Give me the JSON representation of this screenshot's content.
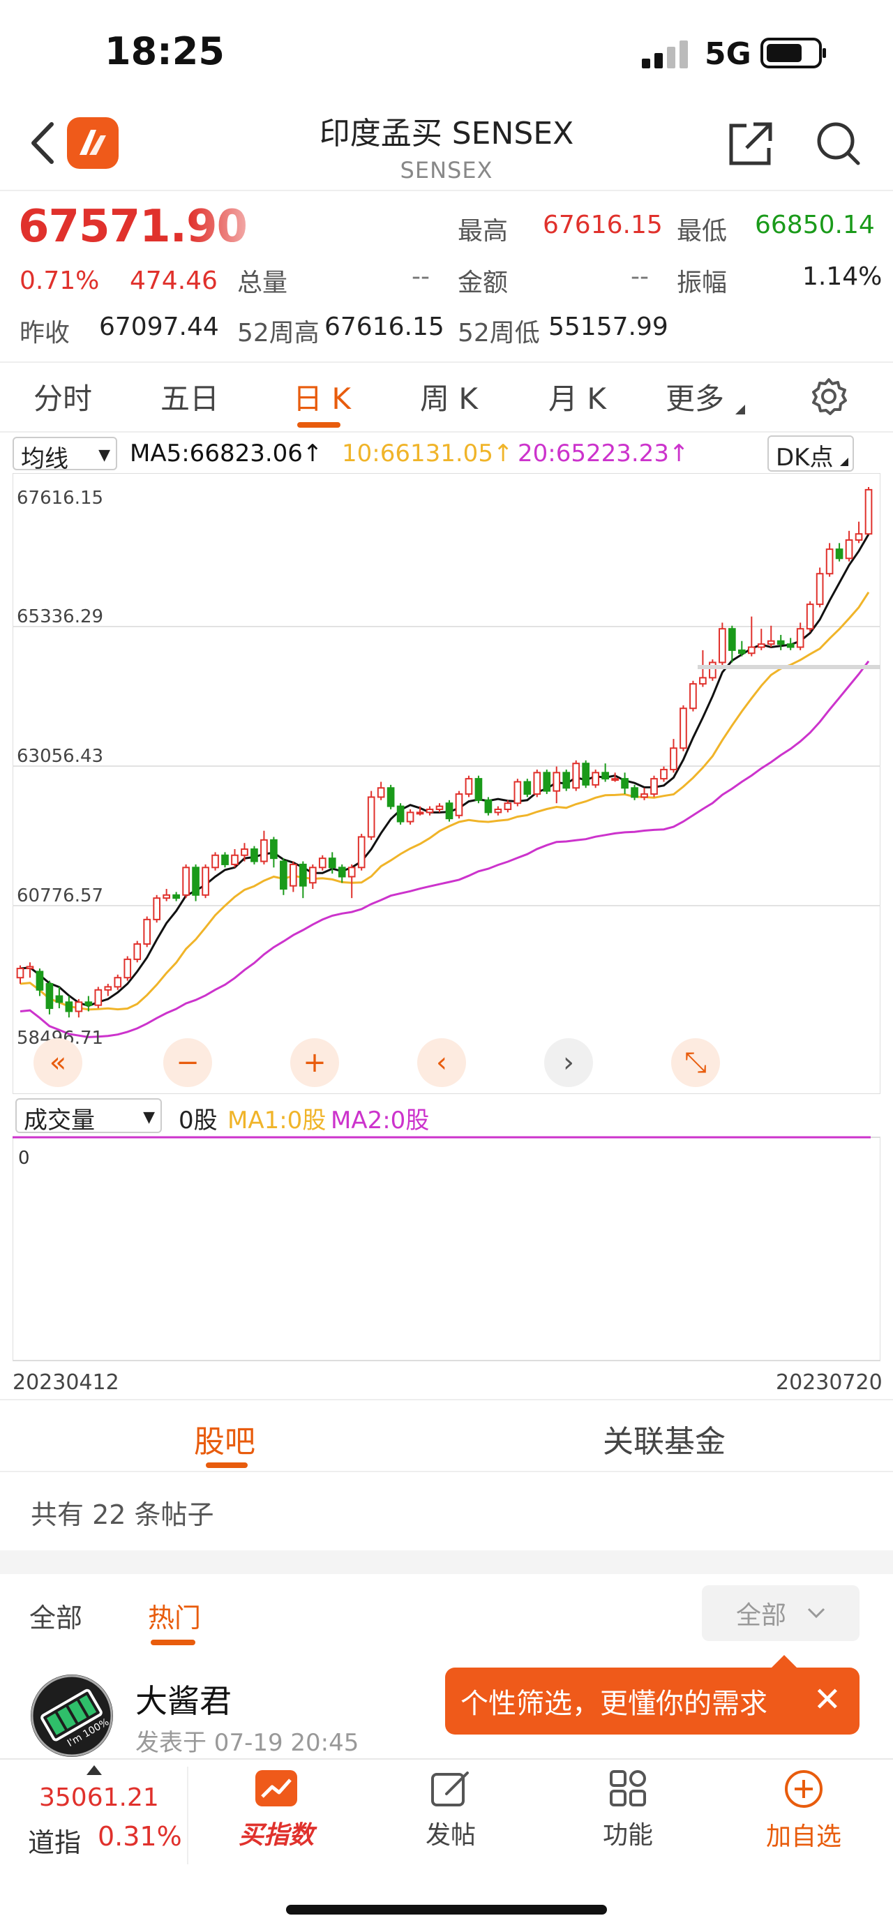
{
  "status_bar": {
    "time": "18:25",
    "network": "5G"
  },
  "header": {
    "title": "印度孟买 SENSEX",
    "subtitle": "SENSEX"
  },
  "quote": {
    "price": "67571.90",
    "change_pct": "0.71%",
    "change_abs": "474.46",
    "high_label": "最高",
    "high": "67616.15",
    "low_label": "最低",
    "low": "66850.14",
    "volume_label": "总量",
    "volume": "--",
    "amount_label": "金额",
    "amount": "--",
    "amplitude_label": "振幅",
    "amplitude": "1.14%",
    "prev_close_label": "昨收",
    "prev_close": "67097.44",
    "week52_high_label": "52周高",
    "week52_high": "67616.15",
    "week52_low_label": "52周低",
    "week52_low": "55157.99"
  },
  "chart_tabs": [
    "分时",
    "五日",
    "日 K",
    "周 K",
    "月 K",
    "更多"
  ],
  "ma_bar": {
    "selector": "均线",
    "ma5": "MA5:66823.06",
    "ma10": "10:66131.05",
    "ma20": "20:65223.23",
    "dk": "DK点"
  },
  "colors": {
    "up": "#e0312c",
    "down": "#1a9a1a",
    "ma5": "#111111",
    "ma10": "#f0b429",
    "ma20": "#cc33cc",
    "accent": "#e85c0d"
  },
  "chart_data": {
    "type": "candlestick",
    "y_ticks": [
      "67616.15",
      "65336.29",
      "63056.43",
      "60776.57",
      "58496.71"
    ],
    "ylim": [
      58496.71,
      67616.15
    ],
    "x_start": "20230412",
    "x_end": "20230720",
    "candles": [
      [
        59600,
        59750,
        59500,
        59800
      ],
      [
        59750,
        59780,
        59600,
        59850
      ],
      [
        59700,
        59400,
        59300,
        59750
      ],
      [
        59500,
        59100,
        59000,
        59550
      ],
      [
        59300,
        59200,
        59100,
        59450
      ],
      [
        59200,
        59050,
        58950,
        59300
      ],
      [
        59050,
        59200,
        58950,
        59250
      ],
      [
        59200,
        59150,
        59050,
        59300
      ],
      [
        59150,
        59400,
        59100,
        59450
      ],
      [
        59400,
        59450,
        59300,
        59500
      ],
      [
        59450,
        59600,
        59400,
        59650
      ],
      [
        59600,
        59900,
        59550,
        59950
      ],
      [
        59900,
        60150,
        59850,
        60200
      ],
      [
        60150,
        60550,
        60100,
        60600
      ],
      [
        60550,
        60900,
        60500,
        60950
      ],
      [
        60900,
        60950,
        60850,
        61050
      ],
      [
        60950,
        60900,
        60850,
        61000
      ],
      [
        60950,
        61400,
        60900,
        61450
      ],
      [
        61400,
        60950,
        60850,
        61450
      ],
      [
        60950,
        61400,
        60900,
        61450
      ],
      [
        61400,
        61600,
        61350,
        61650
      ],
      [
        61600,
        61450,
        61400,
        61650
      ],
      [
        61450,
        61600,
        61400,
        61700
      ],
      [
        61600,
        61700,
        61500,
        61800
      ],
      [
        61700,
        61500,
        61450,
        61750
      ],
      [
        61500,
        61850,
        61450,
        62000
      ],
      [
        61850,
        61550,
        61400,
        61900
      ],
      [
        61500,
        61050,
        60950,
        61550
      ],
      [
        61100,
        61450,
        61000,
        61500
      ],
      [
        61450,
        61100,
        60900,
        61500
      ],
      [
        61150,
        61400,
        61050,
        61450
      ],
      [
        61400,
        61550,
        61350,
        61600
      ],
      [
        61550,
        61400,
        61300,
        61650
      ],
      [
        61400,
        61250,
        61150,
        61450
      ],
      [
        61250,
        61400,
        60900,
        61450
      ],
      [
        61400,
        61900,
        61350,
        61950
      ],
      [
        61900,
        62550,
        61850,
        62650
      ],
      [
        62550,
        62700,
        62500,
        62800
      ],
      [
        62700,
        62400,
        62350,
        62750
      ],
      [
        62400,
        62150,
        62100,
        62450
      ],
      [
        62150,
        62300,
        62100,
        62350
      ],
      [
        62300,
        62300,
        62250,
        62400
      ],
      [
        62300,
        62350,
        62250,
        62400
      ],
      [
        62350,
        62400,
        62300,
        62450
      ],
      [
        62450,
        62200,
        62150,
        62500
      ],
      [
        62250,
        62600,
        62200,
        62650
      ],
      [
        62600,
        62850,
        62550,
        62900
      ],
      [
        62850,
        62500,
        62450,
        62900
      ],
      [
        62500,
        62300,
        62250,
        62550
      ],
      [
        62300,
        62350,
        62250,
        62400
      ],
      [
        62350,
        62450,
        62300,
        62500
      ],
      [
        62450,
        62800,
        62400,
        62850
      ],
      [
        62800,
        62600,
        62550,
        62850
      ],
      [
        62600,
        62950,
        62550,
        63000
      ],
      [
        62950,
        62650,
        62600,
        63000
      ],
      [
        62650,
        62950,
        62450,
        63050
      ],
      [
        62950,
        62700,
        62650,
        63000
      ],
      [
        62700,
        63100,
        62650,
        63150
      ],
      [
        63100,
        62750,
        62700,
        63150
      ],
      [
        62750,
        62950,
        62700,
        63000
      ],
      [
        62950,
        62850,
        62800,
        63100
      ],
      [
        62850,
        62850,
        62800,
        62950
      ],
      [
        62850,
        62700,
        62600,
        62950
      ],
      [
        62700,
        62550,
        62500,
        62750
      ],
      [
        62550,
        62600,
        62500,
        62700
      ],
      [
        62600,
        62850,
        62550,
        62900
      ],
      [
        62850,
        63000,
        62800,
        63050
      ],
      [
        63000,
        63350,
        62950,
        63500
      ],
      [
        63350,
        64000,
        63300,
        64050
      ],
      [
        64000,
        64400,
        63950,
        64450
      ],
      [
        64400,
        64500,
        64350,
        64950
      ],
      [
        64500,
        64750,
        64450,
        64800
      ],
      [
        64750,
        65300,
        64700,
        65400
      ],
      [
        65300,
        64950,
        64750,
        65350
      ],
      [
        64950,
        64900,
        64850,
        65100
      ],
      [
        64900,
        65000,
        64850,
        65500
      ],
      [
        65000,
        65050,
        64950,
        65300
      ],
      [
        65050,
        65100,
        65000,
        65350
      ],
      [
        65100,
        65050,
        64950,
        65200
      ],
      [
        65050,
        65000,
        64950,
        65150
      ],
      [
        65000,
        65300,
        64950,
        65400
      ],
      [
        65300,
        65700,
        65250,
        65750
      ],
      [
        65700,
        66200,
        65650,
        66300
      ],
      [
        66200,
        66600,
        66150,
        66700
      ],
      [
        66600,
        66450,
        66400,
        66700
      ],
      [
        66450,
        66750,
        66400,
        66900
      ],
      [
        66750,
        66850,
        66700,
        67050
      ],
      [
        66850,
        67572,
        66850,
        67616
      ]
    ]
  },
  "volume_bar": {
    "selector": "成交量",
    "value": "0股",
    "ma1": "MA1:0股",
    "ma2": "MA2:0股",
    "axis_zero": "0"
  },
  "sections": {
    "tab1": "股吧",
    "tab2": "关联基金",
    "post_count": "共有 22 条帖子"
  },
  "filter": {
    "all": "全部",
    "hot": "热门",
    "dropdown": "全部"
  },
  "tooltip": {
    "text": "个性筛选，更懂你的需求"
  },
  "post": {
    "author": "大酱君",
    "time": "发表于 07-19 20:45",
    "avatar_text": "I'm 100%"
  },
  "bottom_bar": {
    "ticker_price": "35061.21",
    "ticker_name": "道指",
    "ticker_change": "0.31%",
    "nav": [
      "买指数",
      "发帖",
      "功能",
      "加自选"
    ]
  }
}
